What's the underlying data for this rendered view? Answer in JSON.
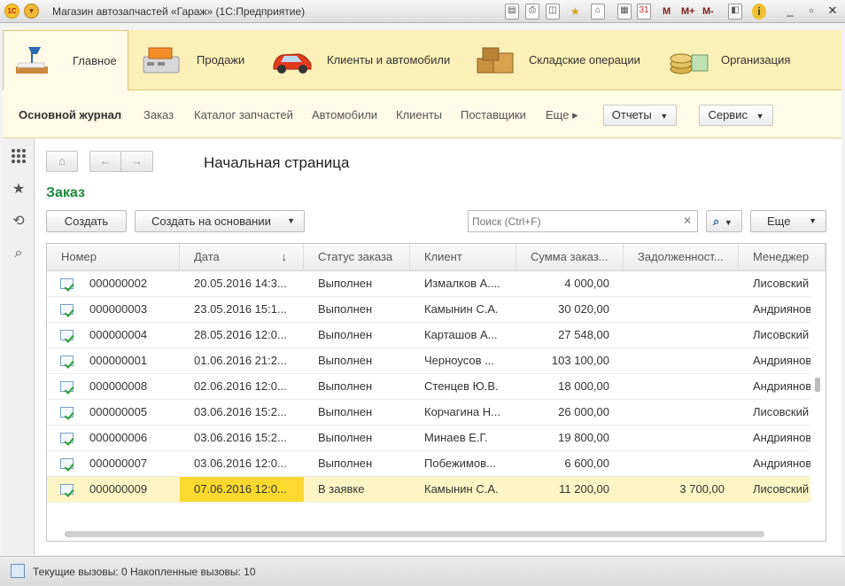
{
  "window": {
    "title": "Магазин автозапчастей «Гараж» (1С:Предприятие)",
    "logo": "1С",
    "toolbar_icons": [
      "save-icon",
      "print-icon",
      "preview-icon",
      "favorite-icon",
      "home-icon",
      "calculator-icon",
      "calendar-icon",
      "compare-icon",
      "info-icon",
      "minimize-icon",
      "restore-icon",
      "close-icon"
    ],
    "memory_buttons": [
      "M",
      "M+",
      "M-"
    ]
  },
  "sections": [
    {
      "label": "Главное",
      "icon": "desk-lamp-icon",
      "active": true
    },
    {
      "label": "Продажи",
      "icon": "cash-register-icon",
      "active": false
    },
    {
      "label": "Клиенты и автомобили",
      "icon": "car-icon",
      "active": false
    },
    {
      "label": "Складские операции",
      "icon": "boxes-icon",
      "active": false
    },
    {
      "label": "Организация",
      "icon": "coins-icon",
      "active": false
    }
  ],
  "function_panel": {
    "items": [
      "Основной журнал",
      "Заказ",
      "Каталог запчастей",
      "Автомобили",
      "Клиенты",
      "Поставщики",
      "Еще ▸"
    ],
    "reports_label": "Отчеты",
    "service_label": "Сервис"
  },
  "left_tools": [
    "apps-grid-icon",
    "star-icon",
    "history-icon",
    "search-icon"
  ],
  "page": {
    "title": "Начальная страница",
    "form_title": "Заказ",
    "create_label": "Создать",
    "create_based_label": "Создать на основании",
    "search_placeholder": "Поиск (Ctrl+F)",
    "more_label": "Еще"
  },
  "table": {
    "columns": [
      "Номер",
      "Дата",
      "Статус заказа",
      "Клиент",
      "Сумма заказ...",
      "Задолженност...",
      "Менеджер"
    ],
    "rows": [
      {
        "number": "000000002",
        "date": "20.05.2016 14:3...",
        "status": "Выполнен",
        "client": "Измалков А....",
        "sum": "4 000,00",
        "debt": "",
        "manager": "Лисовский"
      },
      {
        "number": "000000003",
        "date": "23.05.2016 15:1...",
        "status": "Выполнен",
        "client": "Камынин С.А.",
        "sum": "30 020,00",
        "debt": "",
        "manager": "Андриянов"
      },
      {
        "number": "000000004",
        "date": "28.05.2016 12:0...",
        "status": "Выполнен",
        "client": "Карташов А...",
        "sum": "27 548,00",
        "debt": "",
        "manager": "Лисовский"
      },
      {
        "number": "000000001",
        "date": "01.06.2016 21:2...",
        "status": "Выполнен",
        "client": "Черноусов ...",
        "sum": "103 100,00",
        "debt": "",
        "manager": "Андриянов"
      },
      {
        "number": "000000008",
        "date": "02.06.2016 12:0...",
        "status": "Выполнен",
        "client": "Стенцев Ю.В.",
        "sum": "18 000,00",
        "debt": "",
        "manager": "Андриянов"
      },
      {
        "number": "000000005",
        "date": "03.06.2016 15:2...",
        "status": "Выполнен",
        "client": "Корчагина Н...",
        "sum": "26 000,00",
        "debt": "",
        "manager": "Лисовский"
      },
      {
        "number": "000000006",
        "date": "03.06.2016 15:2...",
        "status": "Выполнен",
        "client": "Минаев Е.Г.",
        "sum": "19 800,00",
        "debt": "",
        "manager": "Андриянов"
      },
      {
        "number": "000000007",
        "date": "03.06.2016 12:0...",
        "status": "Выполнен",
        "client": "Побежимов...",
        "sum": "6 600,00",
        "debt": "",
        "manager": "Андриянов"
      },
      {
        "number": "000000009",
        "date": "07.06.2016 12:0...",
        "status": "В заявке",
        "client": "Камынин С.А.",
        "sum": "11 200,00",
        "debt": "3 700,00",
        "manager": "Лисовский",
        "selected": true
      }
    ]
  },
  "status_bar": {
    "current_calls": "Текущие вызовы: 0",
    "accumulated_calls": "Накопленные вызовы: 10"
  }
}
